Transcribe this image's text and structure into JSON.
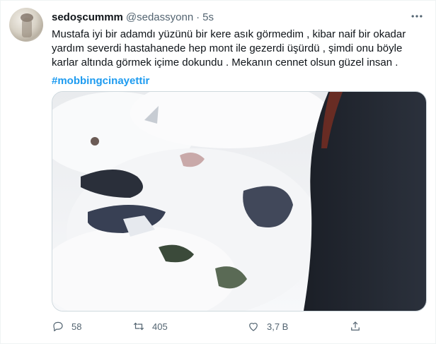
{
  "tweet": {
    "display_name": "sedoşcummm",
    "handle": "@sedassyonn",
    "separator": "·",
    "time": "5s",
    "text": "Mustafa iyi bir adamdı yüzünü bir kere asık görmedim , kibar naif bir okadar\nyardım severdi  hastahanede hep mont ile gezerdi üşürdü , şimdi onu böyle\nkarlar altında görmek içime dokundu . Mekanın cennet olsun güzel insan .",
    "hashtag": "#mobbingcinayettir"
  },
  "actions": {
    "reply_count": "58",
    "retweet_count": "405",
    "like_count": "3,7 B",
    "share_label": ""
  },
  "icons": {
    "more": "more-horizontal-icon",
    "reply": "reply-icon",
    "retweet": "retweet-icon",
    "like": "heart-icon",
    "share": "share-icon"
  },
  "colors": {
    "accent": "#1d9bf0",
    "secondary_text": "#536471",
    "primary_text": "#0f1419"
  }
}
